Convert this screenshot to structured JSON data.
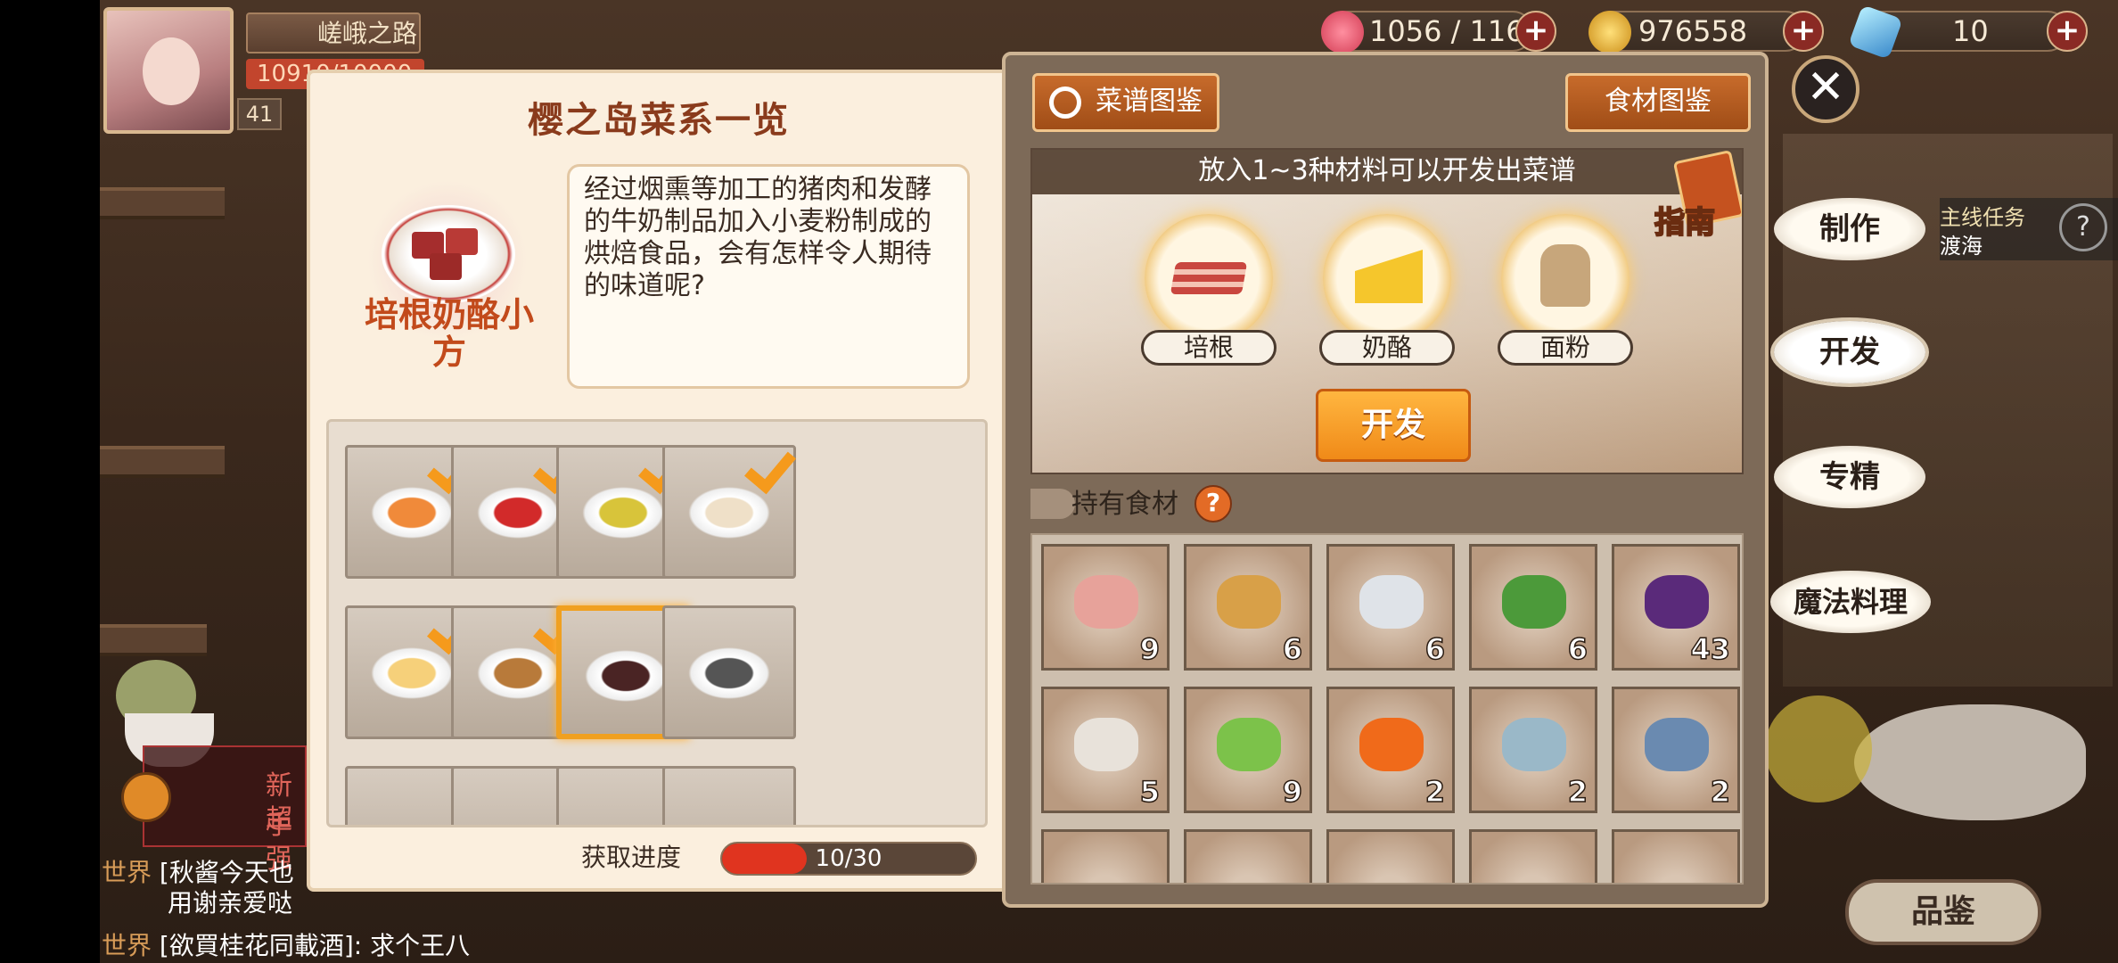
{
  "player": {
    "name": "嵯峨之路",
    "exp": "10910/10000",
    "level": "41"
  },
  "resources": {
    "stamina": "1056 / 116",
    "gold": "976558",
    "gems": "10"
  },
  "left_panel": {
    "title": "樱之岛菜系一览",
    "dish_name": "培根奶酪小方",
    "description": "经过烟熏等加工的猪肉和发酵的牛奶制品加入小麦粉制成的烘焙食品，会有怎样令人期待的味道呢?",
    "progress_label": "获取进度",
    "progress_text": "10/30",
    "progress_value": 0.333,
    "recipes": [
      {
        "food": "sushi-icon",
        "done": true
      },
      {
        "food": "tartare-icon",
        "done": true
      },
      {
        "food": "tamagoyaki-icon",
        "done": true
      },
      {
        "food": "gratin-icon",
        "done": true
      },
      {
        "food": "omurice-icon",
        "done": true
      },
      {
        "food": "karaage-icon",
        "done": true
      },
      {
        "food": "bacon-cheese-cube-icon",
        "done": false,
        "selected": true
      },
      {
        "food": "unknown-dish-icon",
        "done": false
      }
    ]
  },
  "right_panel": {
    "recipe_book_button": "菜谱图鉴",
    "ingredient_book_button": "食材图鉴",
    "dev_hint": "放入1~3种材料可以开发出菜谱",
    "guide_label": "指南",
    "slots": [
      {
        "label": "培根"
      },
      {
        "label": "奶酪"
      },
      {
        "label": "面粉"
      }
    ],
    "develop_button": "开发",
    "owned_label": "持有食材",
    "inventory": [
      {
        "icon": "bacon-icon",
        "qty": "9"
      },
      {
        "icon": "potato-icon",
        "qty": "6"
      },
      {
        "icon": "squid-icon",
        "qty": "6"
      },
      {
        "icon": "cucumber-icon",
        "qty": "6"
      },
      {
        "icon": "eggplant-icon",
        "qty": "43"
      },
      {
        "icon": "oyster-icon",
        "qty": "5"
      },
      {
        "icon": "lettuce-icon",
        "qty": "9"
      },
      {
        "icon": "carrot-icon",
        "qty": "2"
      },
      {
        "icon": "shrimp-icon",
        "qty": "2"
      },
      {
        "icon": "fish-icon",
        "qty": "2"
      }
    ]
  },
  "side_nav": {
    "make": "制作",
    "develop": "开发",
    "specialize": "专精",
    "magic": "魔法料理",
    "appraise": "品鉴"
  },
  "quest": {
    "line1": "主线任务",
    "line2": "渡海"
  },
  "event_banner": {
    "line1": "新手",
    "line2": "超强"
  },
  "chat": {
    "line1_channel": "世界",
    "line1_text": "[秋酱今天也",
    "line2_text": "用谢亲爱哒",
    "line3_channel": "世界",
    "line3_text": "[欲買桂花同載酒]: 求个王八"
  }
}
